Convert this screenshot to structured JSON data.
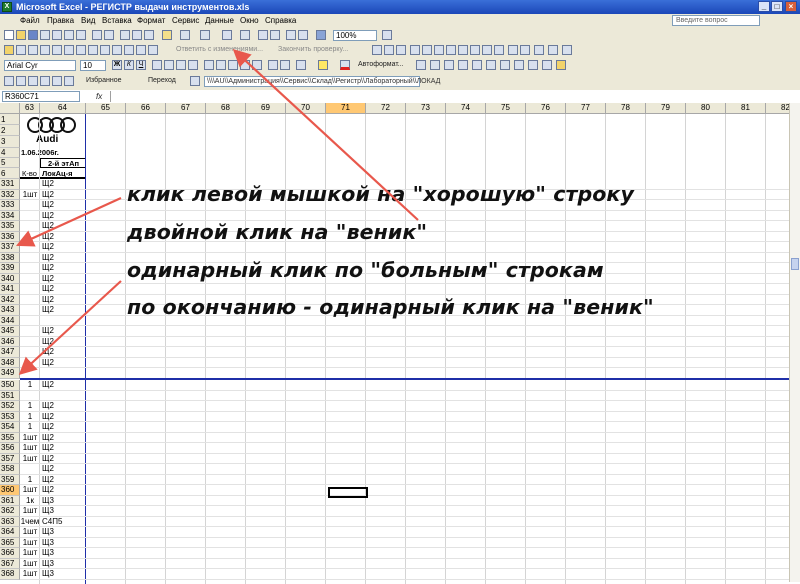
{
  "window": {
    "title": "Microsoft Excel - РЕГИСТР выдачи инструментов.xls",
    "min": "_",
    "max": "□",
    "close": "×"
  },
  "menu": {
    "items": [
      "Файл",
      "Правка",
      "Вид",
      "Вставка",
      "Формат",
      "Сервис",
      "Данные",
      "Окно",
      "Справка"
    ],
    "ask_placeholder": "Введите вопрос"
  },
  "toolbar": {
    "zoom": "100%",
    "font": "Arial Cyr",
    "size": "10",
    "review_reply": "Ответить с изменениями...",
    "review_end": "Закончить проверку...",
    "autoformat": "Автоформат...",
    "favorites": "Избранное",
    "goto": "Переход",
    "web_path": "\\\\\\\\AU\\\\Администрация\\\\Сервис\\\\Склад\\\\Регистр\\\\Лабораторный\\\\ЛОКАД"
  },
  "formula_bar": {
    "namebox": "R360C71",
    "fx": "fx"
  },
  "sheet": {
    "columns": [
      "63",
      "64",
      "65",
      "66",
      "67",
      "68",
      "69",
      "70",
      "71",
      "72",
      "73",
      "74",
      "75",
      "76",
      "77",
      "78",
      "79",
      "80",
      "81",
      "82"
    ],
    "selected_col": "71",
    "top_rows": [
      "1",
      "2",
      "3",
      "4",
      "5",
      "6"
    ],
    "date": "1.06.2006г.",
    "logo_text": "Audi",
    "header_stage": "2-й этАп",
    "header_qty": "К-во",
    "header_loc": "ЛокАц-я",
    "upper_rows": [
      {
        "n": "331",
        "q": "",
        "l": "Щ2"
      },
      {
        "n": "332",
        "q": "1шт",
        "l": "Щ2"
      },
      {
        "n": "333",
        "q": "",
        "l": "Щ2"
      },
      {
        "n": "334",
        "q": "",
        "l": "Щ2"
      },
      {
        "n": "335",
        "q": "",
        "l": "Щ2"
      },
      {
        "n": "336",
        "q": "",
        "l": "Щ2"
      },
      {
        "n": "337",
        "q": "",
        "l": "Щ2"
      },
      {
        "n": "338",
        "q": "",
        "l": "Щ2"
      },
      {
        "n": "339",
        "q": "",
        "l": "Щ2"
      },
      {
        "n": "340",
        "q": "",
        "l": "Щ2"
      },
      {
        "n": "341",
        "q": "",
        "l": "Щ2"
      },
      {
        "n": "342",
        "q": "",
        "l": "Щ2"
      },
      {
        "n": "343",
        "q": "",
        "l": "Щ2"
      },
      {
        "n": "344",
        "q": "",
        "l": ""
      },
      {
        "n": "345",
        "q": "",
        "l": "Щ2"
      },
      {
        "n": "346",
        "q": "",
        "l": "Щ2"
      },
      {
        "n": "347",
        "q": "",
        "l": "Щ2"
      },
      {
        "n": "348",
        "q": "",
        "l": "Щ2"
      },
      {
        "n": "349",
        "q": "",
        "l": ""
      }
    ],
    "lower_rows": [
      {
        "n": "350",
        "q": "1",
        "l": "Щ2"
      },
      {
        "n": "351",
        "q": "",
        "l": ""
      },
      {
        "n": "352",
        "q": "1",
        "l": "Щ2"
      },
      {
        "n": "353",
        "q": "1",
        "l": "Щ2"
      },
      {
        "n": "354",
        "q": "1",
        "l": "Щ2"
      },
      {
        "n": "355",
        "q": "1шт",
        "l": "Щ2"
      },
      {
        "n": "356",
        "q": "1шт",
        "l": "Щ2"
      },
      {
        "n": "357",
        "q": "1шт",
        "l": "Щ2"
      },
      {
        "n": "358",
        "q": "",
        "l": "Щ2"
      },
      {
        "n": "359",
        "q": "1",
        "l": "Щ2"
      },
      {
        "n": "360",
        "q": "1шт",
        "l": "Щ2"
      },
      {
        "n": "361",
        "q": "1к",
        "l": "Щ3"
      },
      {
        "n": "362",
        "q": "1шт",
        "l": "Щ3"
      },
      {
        "n": "363",
        "q": "1чем",
        "l": "С4П5"
      },
      {
        "n": "364",
        "q": "1шт",
        "l": "Щ3"
      },
      {
        "n": "365",
        "q": "1шт",
        "l": "Щ3"
      },
      {
        "n": "366",
        "q": "1шт",
        "l": "Щ3"
      },
      {
        "n": "367",
        "q": "1шт",
        "l": "Щ3"
      },
      {
        "n": "368",
        "q": "1шт",
        "l": "Щ3"
      }
    ],
    "selected_row": "360"
  },
  "instructions": {
    "line1": "клик левой мышкой на \"хорошую\" строку",
    "line2": "двойной клик на \"веник\"",
    "line3": "одинарный клик по \"больным\" строкам",
    "line4": "по окончанию  - одинарный  клик на \"веник\""
  },
  "colors": {
    "arrow": "#e8584c",
    "accent": "#ffc873",
    "title": "#1b47b8",
    "blue_border": "#1f2fa8"
  }
}
